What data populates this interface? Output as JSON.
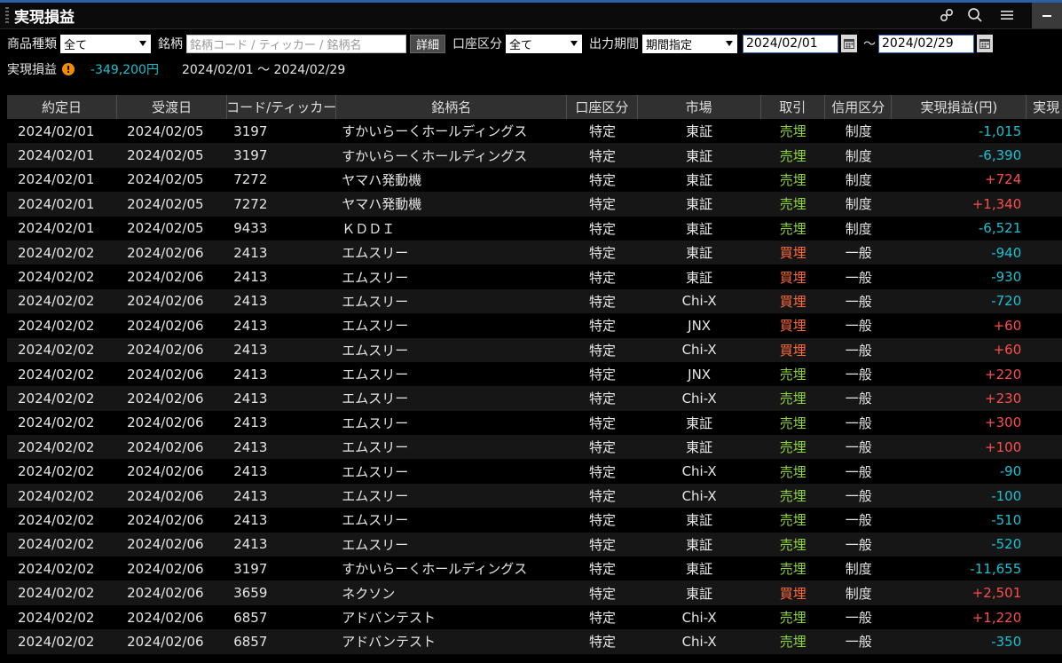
{
  "window": {
    "title": "実現損益"
  },
  "filters": {
    "product_type_label": "商品種類",
    "product_type_value": "全て",
    "symbol_label": "銘柄",
    "symbol_placeholder": "銘柄コード / ティッカー / 銘柄名",
    "detail_button": "詳細",
    "account_label": "口座区分",
    "account_value": "全て",
    "period_label": "出力期間",
    "period_value": "期間指定",
    "date_from": "2024/02/01",
    "date_to": "2024/02/29",
    "range_sep": "～"
  },
  "summary": {
    "label": "実現損益",
    "warning_icon": "!",
    "amount": "-349,200円",
    "period": "2024/02/01 ～ 2024/02/29"
  },
  "table": {
    "columns": [
      "約定日",
      "受渡日",
      "コード/ティッカー",
      "銘柄名",
      "口座区分",
      "市場",
      "取引",
      "信用区分",
      "実現損益(円)",
      "実現"
    ],
    "rows": [
      [
        "2024/02/01",
        "2024/02/05",
        "3197",
        "すかいらーくホールディングス",
        "特定",
        "東証",
        "売埋",
        "制度",
        "-1,015"
      ],
      [
        "2024/02/01",
        "2024/02/05",
        "3197",
        "すかいらーくホールディングス",
        "特定",
        "東証",
        "売埋",
        "制度",
        "-6,390"
      ],
      [
        "2024/02/01",
        "2024/02/05",
        "7272",
        "ヤマハ発動機",
        "特定",
        "東証",
        "売埋",
        "制度",
        "+724"
      ],
      [
        "2024/02/01",
        "2024/02/05",
        "7272",
        "ヤマハ発動機",
        "特定",
        "東証",
        "売埋",
        "制度",
        "+1,340"
      ],
      [
        "2024/02/01",
        "2024/02/05",
        "9433",
        "ＫＤＤＩ",
        "特定",
        "東証",
        "売埋",
        "制度",
        "-6,521"
      ],
      [
        "2024/02/02",
        "2024/02/06",
        "2413",
        "エムスリー",
        "特定",
        "東証",
        "買埋",
        "一般",
        "-940"
      ],
      [
        "2024/02/02",
        "2024/02/06",
        "2413",
        "エムスリー",
        "特定",
        "東証",
        "買埋",
        "一般",
        "-930"
      ],
      [
        "2024/02/02",
        "2024/02/06",
        "2413",
        "エムスリー",
        "特定",
        "Chi-X",
        "買埋",
        "一般",
        "-720"
      ],
      [
        "2024/02/02",
        "2024/02/06",
        "2413",
        "エムスリー",
        "特定",
        "JNX",
        "買埋",
        "一般",
        "+60"
      ],
      [
        "2024/02/02",
        "2024/02/06",
        "2413",
        "エムスリー",
        "特定",
        "Chi-X",
        "買埋",
        "一般",
        "+60"
      ],
      [
        "2024/02/02",
        "2024/02/06",
        "2413",
        "エムスリー",
        "特定",
        "JNX",
        "売埋",
        "一般",
        "+220"
      ],
      [
        "2024/02/02",
        "2024/02/06",
        "2413",
        "エムスリー",
        "特定",
        "Chi-X",
        "売埋",
        "一般",
        "+230"
      ],
      [
        "2024/02/02",
        "2024/02/06",
        "2413",
        "エムスリー",
        "特定",
        "東証",
        "売埋",
        "一般",
        "+300"
      ],
      [
        "2024/02/02",
        "2024/02/06",
        "2413",
        "エムスリー",
        "特定",
        "東証",
        "売埋",
        "一般",
        "+100"
      ],
      [
        "2024/02/02",
        "2024/02/06",
        "2413",
        "エムスリー",
        "特定",
        "Chi-X",
        "売埋",
        "一般",
        "-90"
      ],
      [
        "2024/02/02",
        "2024/02/06",
        "2413",
        "エムスリー",
        "特定",
        "Chi-X",
        "売埋",
        "一般",
        "-100"
      ],
      [
        "2024/02/02",
        "2024/02/06",
        "2413",
        "エムスリー",
        "特定",
        "東証",
        "売埋",
        "一般",
        "-510"
      ],
      [
        "2024/02/02",
        "2024/02/06",
        "2413",
        "エムスリー",
        "特定",
        "東証",
        "売埋",
        "一般",
        "-520"
      ],
      [
        "2024/02/02",
        "2024/02/06",
        "3197",
        "すかいらーくホールディングス",
        "特定",
        "東証",
        "売埋",
        "制度",
        "-11,655"
      ],
      [
        "2024/02/02",
        "2024/02/06",
        "3659",
        "ネクソン",
        "特定",
        "東証",
        "買埋",
        "制度",
        "+2,501"
      ],
      [
        "2024/02/02",
        "2024/02/06",
        "6857",
        "アドバンテスト",
        "特定",
        "Chi-X",
        "売埋",
        "一般",
        "+1,220"
      ],
      [
        "2024/02/02",
        "2024/02/06",
        "6857",
        "アドバンテスト",
        "特定",
        "Chi-X",
        "売埋",
        "一般",
        "-350"
      ]
    ]
  },
  "colors": {
    "positive": "#ff4d4d",
    "negative": "#19c1d0",
    "sell": "#8fd43b",
    "buy": "#ff6a3a",
    "accent": "#2d5fa8"
  },
  "icons": {
    "titlebar": [
      "link-icon",
      "search-icon",
      "menu-icon",
      "minimize-icon"
    ],
    "calendar": "calendar-icon"
  }
}
